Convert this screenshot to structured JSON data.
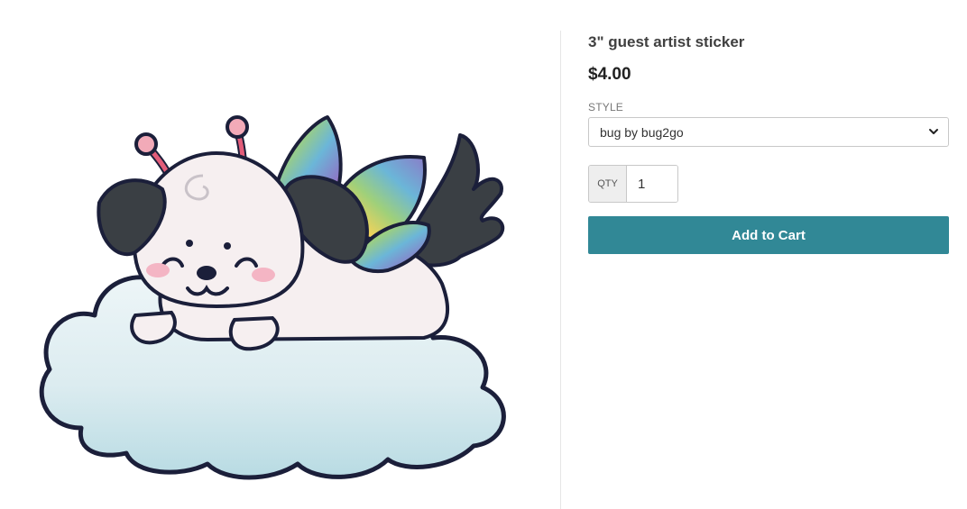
{
  "product": {
    "title": "3\" guest artist sticker",
    "price": "$4.00"
  },
  "style": {
    "label": "STYLE",
    "selected": "bug by bug2go"
  },
  "quantity": {
    "label": "QTY",
    "value": "1"
  },
  "cart": {
    "add_label": "Add to Cart"
  },
  "colors": {
    "button": "#318896",
    "divider": "#e6e6e6"
  },
  "image": {
    "subject": "sticker-illustration"
  }
}
